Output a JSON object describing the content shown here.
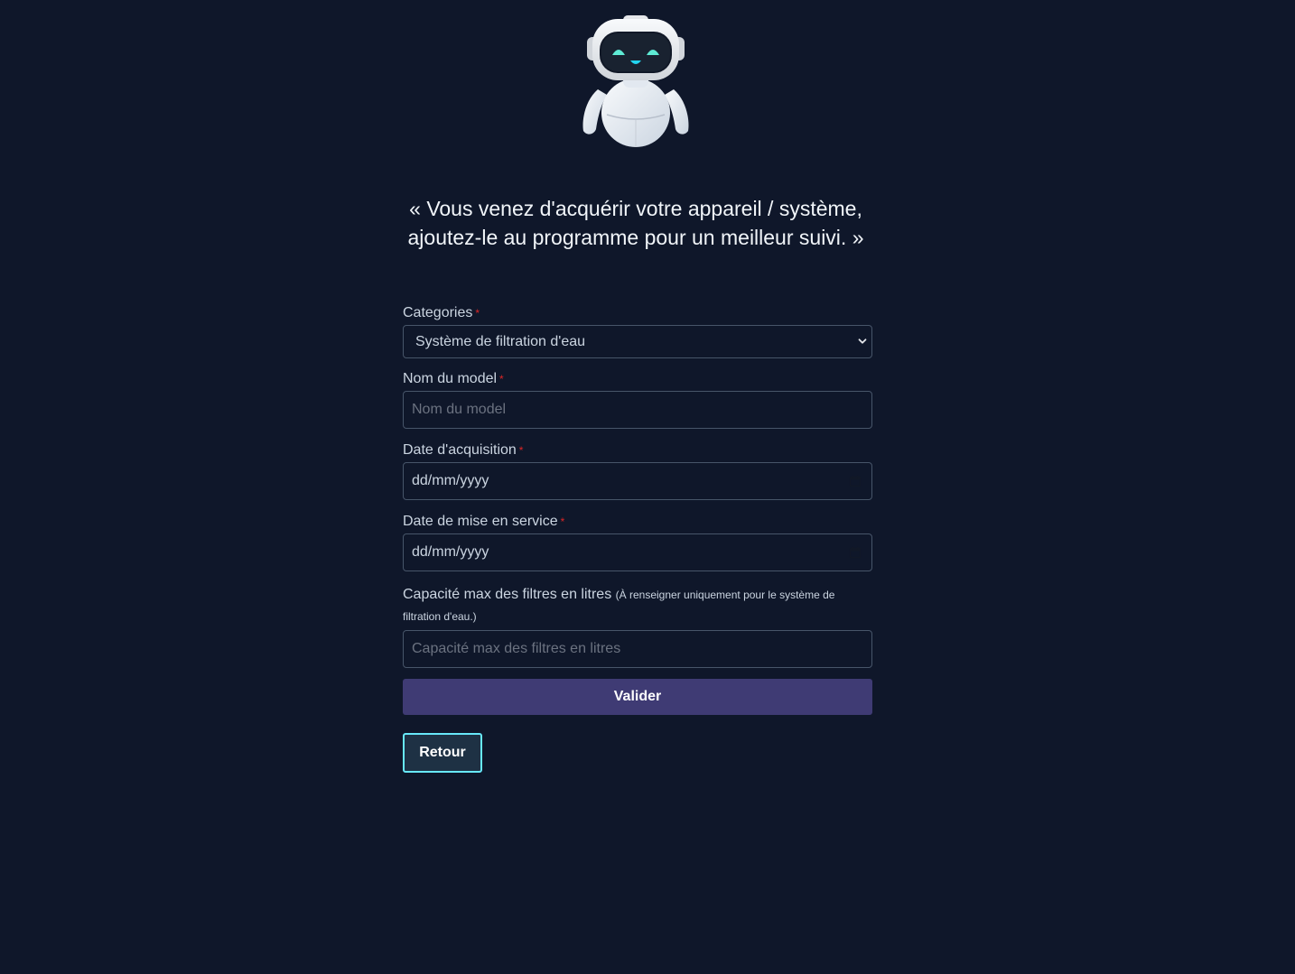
{
  "page": {
    "background": "#0f172a",
    "mascot_icon": "robot-mascot",
    "quote": "« Vous venez d'acquérir votre appareil / système, ajoutez-le au programme pour un meilleur suivi. »"
  },
  "form": {
    "required_marker": "*",
    "category": {
      "label": "Categories",
      "selected": "Système de filtration d'eau",
      "icon": "chevron-down-icon"
    },
    "model_name": {
      "label": "Nom du model",
      "placeholder": "Nom du model",
      "value": ""
    },
    "acquisition_date": {
      "label": "Date d'acquisition",
      "value": "dd/mm/yyyy",
      "icon": "calendar-icon"
    },
    "service_date": {
      "label": "Date de mise en service",
      "value": "dd/mm/yyyy",
      "icon": "calendar-icon"
    },
    "filter_capacity": {
      "label": "Capacité max des filtres en litres",
      "hint": "(À renseigner uniquement pour le système de filtration d'eau.)",
      "placeholder": "Capacité max des filtres en litres",
      "value": ""
    },
    "submit_label": "Valider",
    "back_label": "Retour"
  },
  "colors": {
    "accent_button": "#3f3b74",
    "back_button_border": "#67e8f9",
    "required_marker": "#dc2626"
  }
}
